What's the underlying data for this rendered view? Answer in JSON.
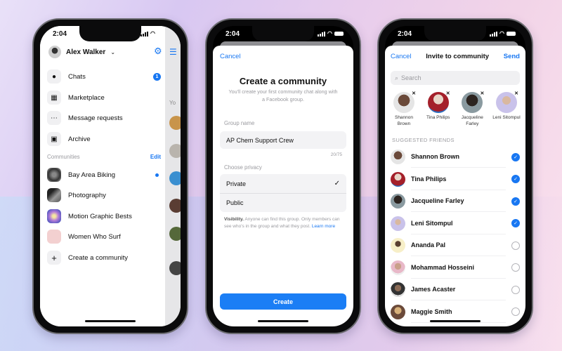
{
  "colors": {
    "accent": "#1877f2",
    "button": "#1b7ef5"
  },
  "status_bar": {
    "time": "2:04"
  },
  "phone1": {
    "profile_name": "Alex Walker",
    "nav_items": [
      {
        "label": "Chats",
        "icon": "chat-bubble-icon",
        "badge": "1"
      },
      {
        "label": "Marketplace",
        "icon": "storefront-icon"
      },
      {
        "label": "Message requests",
        "icon": "message-requests-icon"
      },
      {
        "label": "Archive",
        "icon": "archive-box-icon"
      }
    ],
    "communities_title": "Communities",
    "edit_label": "Edit",
    "communities": [
      {
        "label": "Bay Area Biking",
        "unread": true
      },
      {
        "label": "Photography"
      },
      {
        "label": "Motion Graphic Bests"
      },
      {
        "label": "Women Who Surf"
      }
    ],
    "create_label": "Create a community",
    "side_peek_letter": "Yo"
  },
  "phone2": {
    "cancel": "Cancel",
    "title": "Create a community",
    "subtitle": "You'll create your first community chat along with a Facebook group.",
    "group_name_label": "Group name",
    "group_name_value": "AP Chem Support Crew",
    "char_count": "20/75",
    "privacy_label": "Choose privacy",
    "privacy_options": [
      {
        "label": "Private",
        "selected": true
      },
      {
        "label": "Public",
        "selected": false
      }
    ],
    "visibility_bold": "Visibility.",
    "visibility_text": " Anyone can find this group. Only members can see who's in the group and what they post. ",
    "learn_more": "Learn more",
    "create_button": "Create"
  },
  "phone3": {
    "cancel": "Cancel",
    "title": "Invite to community",
    "send": "Send",
    "search_placeholder": "Search",
    "selected_chips": [
      {
        "name": "Shannon Brown"
      },
      {
        "name": "Tina Philips"
      },
      {
        "name": "Jacqueline Farley"
      },
      {
        "name": "Leni Sitompul"
      }
    ],
    "suggested_title": "SUGGESTED FRIENDS",
    "friends": [
      {
        "name": "Shannon Brown",
        "selected": true
      },
      {
        "name": "Tina Philips",
        "selected": true
      },
      {
        "name": "Jacqueline Farley",
        "selected": true
      },
      {
        "name": "Leni Sitompul",
        "selected": true
      },
      {
        "name": "Ananda Pal",
        "selected": false
      },
      {
        "name": "Mohammad Hosseini",
        "selected": false
      },
      {
        "name": "James Acaster",
        "selected": false
      },
      {
        "name": "Maggie Smith",
        "selected": false
      }
    ]
  }
}
